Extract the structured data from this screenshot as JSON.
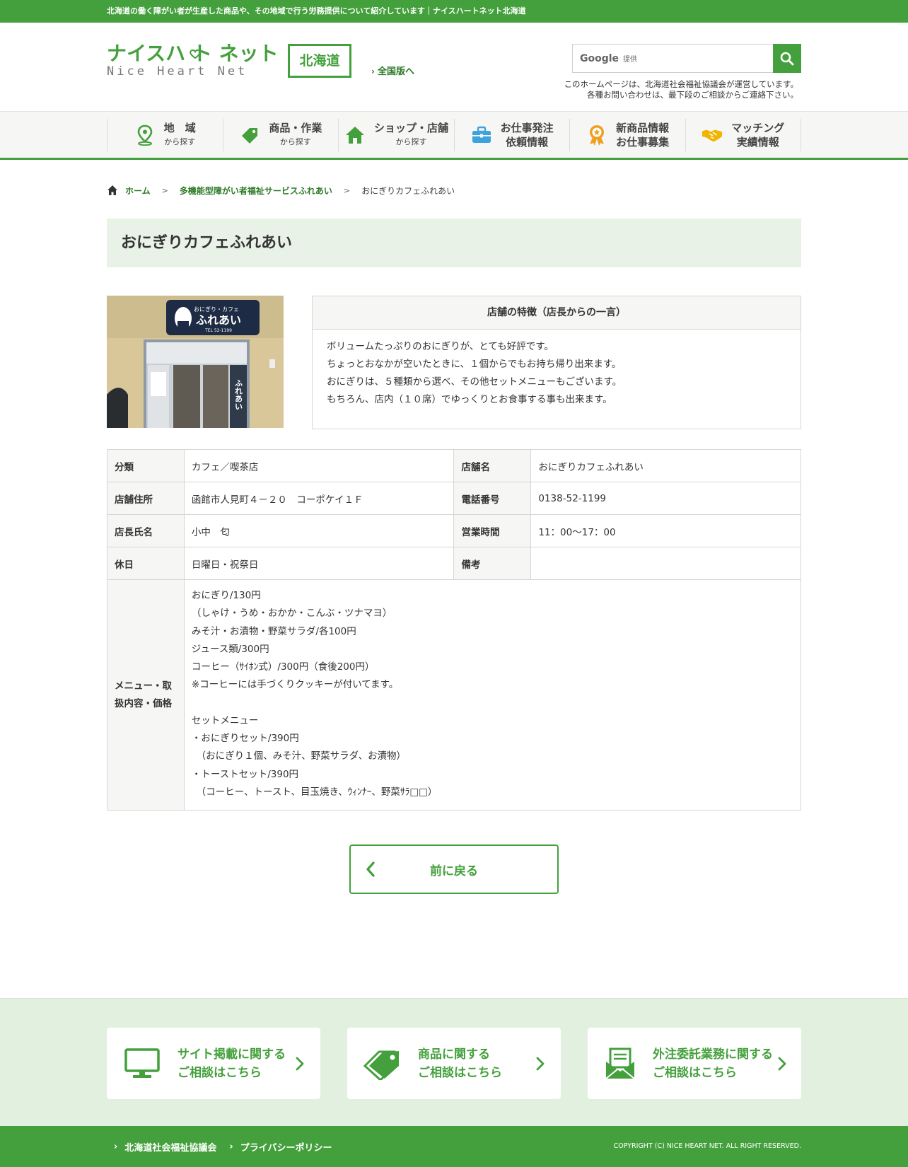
{
  "topbar": {
    "text": "北海道の働く障がい者が生産した商品や、その地域で行う労務提供について紹介しています｜ナイスハートネット北海道"
  },
  "header": {
    "logo_jp": "ナイスハ ト ネット",
    "logo_en": "Nice Heart Net",
    "region": "北海道",
    "national_link": "全国版へ",
    "search_brand": "Google",
    "search_placeholder": "提供",
    "note_line1": "このホームページは、北海道社会福祉協議会が運営しています。",
    "note_line2": "各種お問い合わせは、最下段のご相談からご連絡下さい。"
  },
  "nav": [
    {
      "main": "地　域",
      "sub": "から探す",
      "icon": "map-pin-icon"
    },
    {
      "main": "商品・作業",
      "sub": "から探す",
      "icon": "price-tag-icon"
    },
    {
      "main": "ショップ・店舗",
      "sub": "から探す",
      "icon": "house-icon"
    },
    {
      "main": "お仕事発注",
      "sub": "依頼情報",
      "icon": "briefcase-icon"
    },
    {
      "main": "新商品情報",
      "sub": "お仕事募集",
      "icon": "award-badge-icon"
    },
    {
      "main": "マッチング",
      "sub": "実績情報",
      "icon": "handshake-icon"
    }
  ],
  "breadcrumb": {
    "home": "ホーム",
    "parent": "多機能型障がい者福祉サービスふれあい",
    "current": "おにぎりカフェふれあい"
  },
  "page_title": "おにぎりカフェふれあい",
  "photo": {
    "sign_line1": "おにぎり・カフェ",
    "sign_line2": "ふれあい",
    "sign_tel": "TEL 52-1199",
    "door_text": "ふれあい"
  },
  "feature": {
    "heading": "店舗の特徴（店長からの一言）",
    "lines": [
      "ボリュームたっぷりのおにぎりが、とても好評です。",
      "ちょっとおなかが空いたときに、１個からでもお持ち帰り出来ます。",
      "おにぎりは、５種類から選べ、その他セットメニューもございます。",
      "もちろん、店内（１０席）でゆっくりとお食事する事も出来ます。"
    ]
  },
  "info": {
    "category_label": "分類",
    "category": "カフェ／喫茶店",
    "store_label": "店舗名",
    "store": "おにぎりカフェふれあい",
    "address_label": "店舗住所",
    "address": "函館市人見町４－２０　コーポケイ１Ｆ",
    "phone_label": "電話番号",
    "phone": "0138-52-1199",
    "manager_label": "店長氏名",
    "manager": "小中　匂",
    "hours_label": "営業時間",
    "hours": "11：00～17：00",
    "holiday_label": "休日",
    "holiday": "日曜日・祝祭日",
    "remarks_label": "備考",
    "remarks": "",
    "menu_label": "メニュー・取扱内容・価格",
    "menu_lines": [
      "おにぎり/130円",
      "（しゃけ・うめ・おかか・こんぶ・ツナマヨ）",
      "みそ汁・お漬物・野菜サラダ/各100円",
      "ジュース類/300円",
      "コーヒー（ｻｲﾎﾝ式）/300円（食後200円）",
      "※コーヒーには手づくりクッキーが付いてます。",
      "",
      "セットメニュー",
      "・おにぎりセット/390円",
      "　（おにぎり１個、みそ汁、野菜サラダ、お漬物）",
      "・トーストセット/390円",
      "　（コーヒー、トースト、目玉焼き、ｳｨﾝﾅｰ、野菜ｻﾗ□□）"
    ]
  },
  "back_button": "前に戻る",
  "consult": [
    {
      "line1": "サイト掲載に関する",
      "line2": "ご相談はこちら",
      "icon": "monitor-icon"
    },
    {
      "line1": "商品に関する",
      "line2": "ご相談はこちら",
      "icon": "price-tag-icon"
    },
    {
      "line1": "外注委託業務に関する",
      "line2": "ご相談はこちら",
      "icon": "envelope-icon"
    }
  ],
  "footer": {
    "link1": "北海道社会福祉協議会",
    "link2": "プライバシーポリシー",
    "copyright": "COPYRIGHT (C) NICE HEART NET. ALL RIGHT RESERVED."
  },
  "colors": {
    "brand_green": "#44a03c",
    "title_bg": "#e8f2e6",
    "consult_bg": "#e2f0df",
    "nav_blue": "#3ea3dc",
    "nav_orange": "#f0a020",
    "nav_yellow": "#f2b400"
  }
}
